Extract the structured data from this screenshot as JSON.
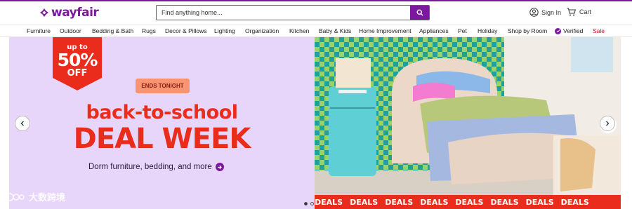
{
  "brand": {
    "name": "wayfair",
    "accent_color": "#7b189f",
    "logo_icon": "wayfair-logo-icon"
  },
  "search": {
    "placeholder": "Find anything home...",
    "button_icon": "search-icon"
  },
  "account": {
    "sign_in_label": "Sign In",
    "icon": "user-icon"
  },
  "cart": {
    "label": "Cart",
    "icon": "cart-icon"
  },
  "nav": {
    "items": [
      "Furniture",
      "Outdoor",
      "Bedding & Bath",
      "Rugs",
      "Decor & Pillows",
      "Lighting",
      "Organization",
      "Kitchen",
      "Baby & Kids",
      "Home Improvement",
      "Appliances",
      "Pet",
      "Holiday",
      "Shop by Room"
    ],
    "verified_label": "Verified",
    "sale_label": "Sale",
    "sale_color": "#c0101d"
  },
  "hero": {
    "badge": {
      "up_to": "up to",
      "percent": "50%",
      "off": "OFF"
    },
    "ends_tonight": "ENDS TONIGHT",
    "headline_1": "back-to-school",
    "headline_2": "DEAL WEEK",
    "subline": "Dorm furniture, bedding, and more",
    "headline_color": "#ea2c1c",
    "background_color": "#e7d6fa",
    "deals_strip": [
      "DEALS",
      "DEALS",
      "DEALS",
      "DEALS",
      "DEALS",
      "DEALS",
      "DEALS",
      "DEALS"
    ],
    "prev_icon": "chevron-left-icon",
    "next_icon": "chevron-right-icon",
    "pagination": {
      "active_index": 0,
      "count": 2
    }
  },
  "watermark": {
    "text": "大数跨境"
  }
}
